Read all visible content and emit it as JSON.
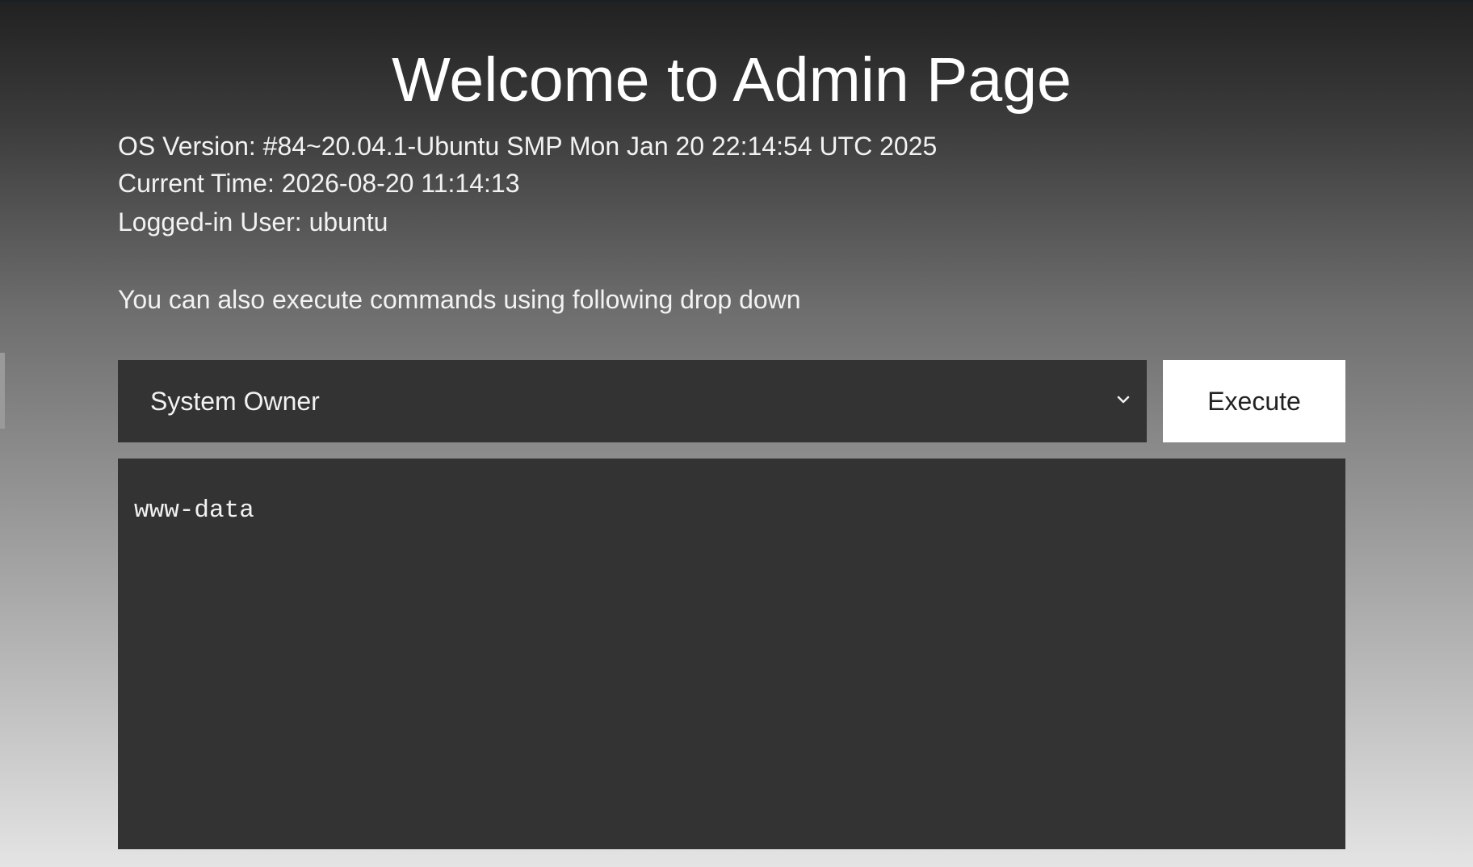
{
  "page": {
    "title": "Welcome to Admin Page"
  },
  "system_info": {
    "os_version": "OS Version: #84~20.04.1-Ubuntu SMP Mon Jan 20 22:14:54 UTC 2025",
    "current_time": "Current Time: 2026-08-20 11:14:13",
    "logged_in_user": "Logged-in User: ubuntu"
  },
  "instructions": "You can also execute commands using following drop down",
  "command_form": {
    "selected_command": "System Owner",
    "execute_label": "Execute"
  },
  "output": {
    "text": "www-data"
  },
  "icons": {
    "dropdown": "chevron-down-icon"
  },
  "colors": {
    "panel": "#333333",
    "button": "#ffffff"
  }
}
